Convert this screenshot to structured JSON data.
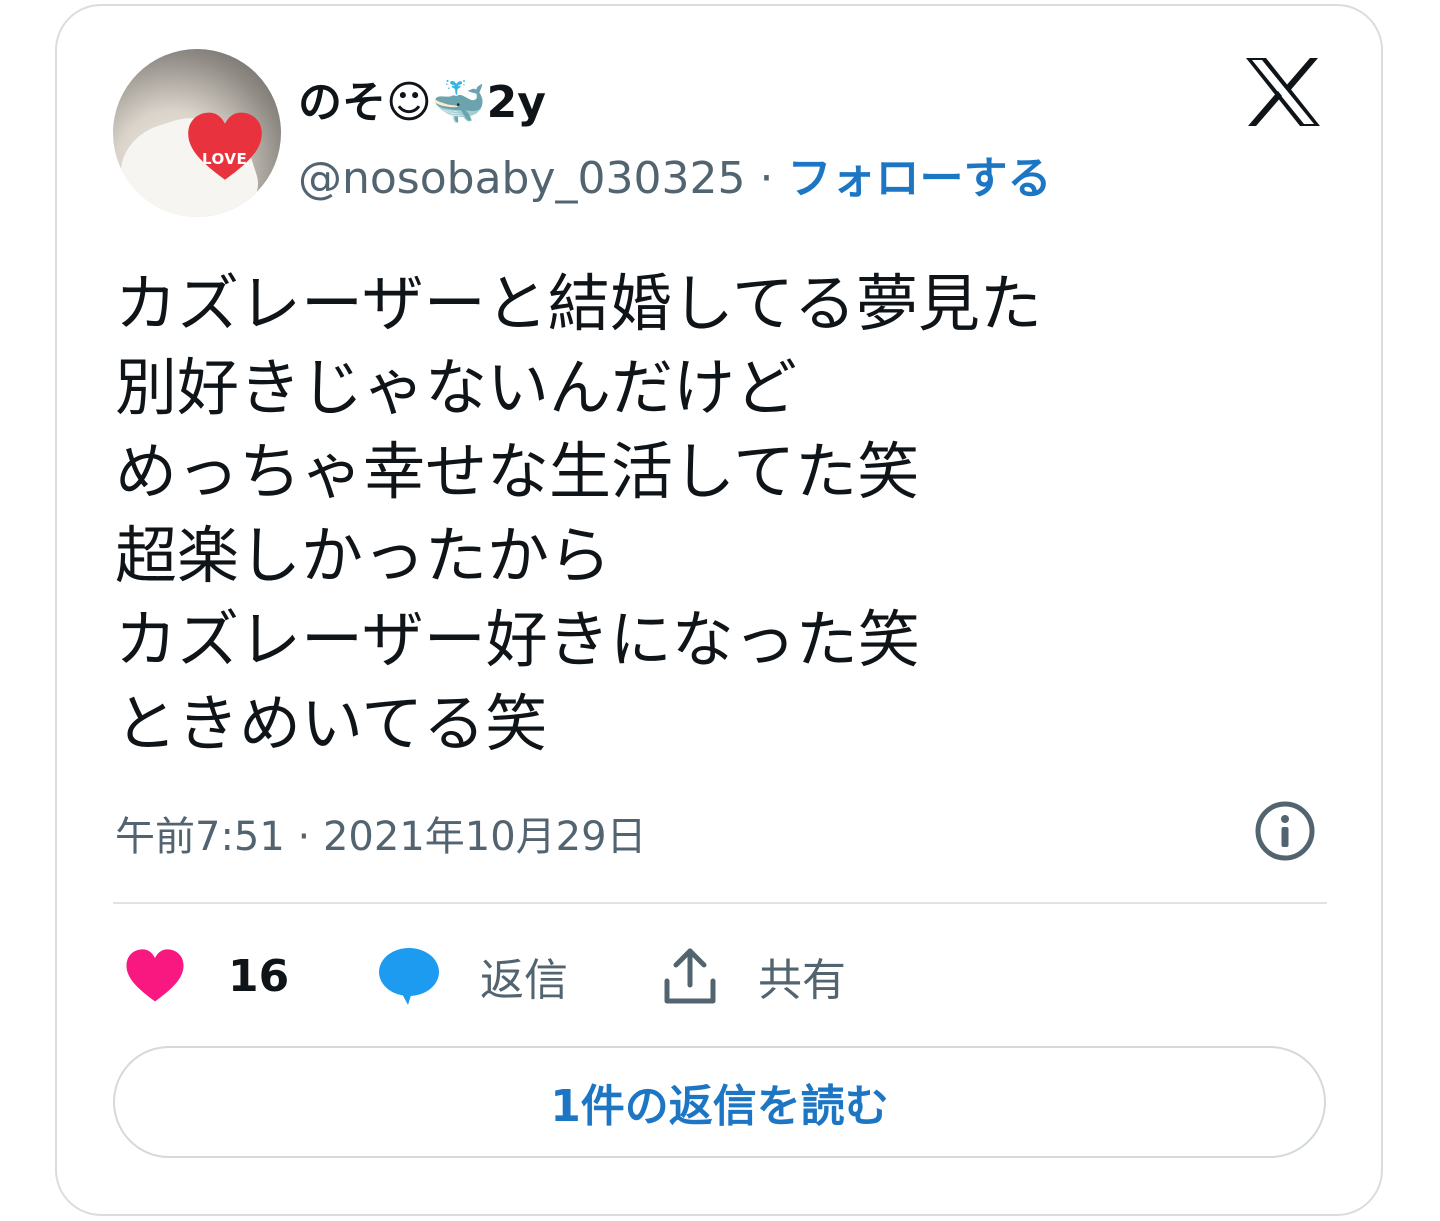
{
  "tweet": {
    "author": {
      "display_name": "のそ☺🐳2y",
      "handle": "@nosobaby_030325",
      "separator": "·",
      "follow_label": "フォローする",
      "avatar_sticker_text": "LOVE"
    },
    "text": "カズレーザーと結婚してる夢見た\n別好きじゃないんだけど\nめっちゃ幸せな生活してた笑\n超楽しかったから\nカズレーザー好きになった笑\nときめいてる笑",
    "timestamp": "午前7:51 · 2021年10月29日",
    "actions": {
      "like_count": "16",
      "reply_label": "返信",
      "share_label": "共有"
    },
    "read_replies_label": "1件の返信を読む"
  },
  "colors": {
    "accent": "#1d76c4",
    "like": "#f91880",
    "reply": "#1d9bf0",
    "muted": "#536471"
  },
  "icons": [
    "x-logo-icon",
    "info-icon",
    "heart-icon",
    "reply-bubble-icon",
    "share-icon"
  ]
}
